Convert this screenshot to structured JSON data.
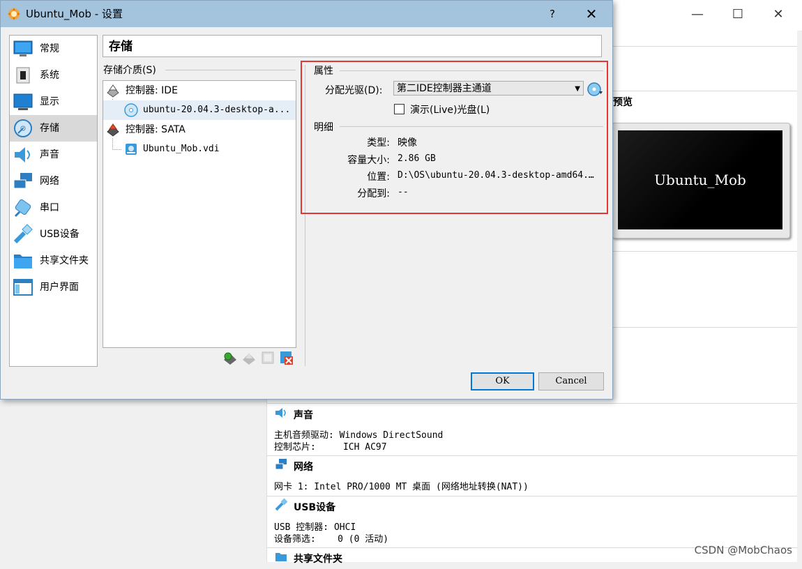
{
  "dialog": {
    "title": "Ubuntu_Mob - 设置",
    "help_label": "?",
    "close_label": "✕",
    "page_title": "存储",
    "sidebar": [
      {
        "id": "general",
        "label": "常规",
        "icon": "monitor-icon"
      },
      {
        "id": "system",
        "label": "系统",
        "icon": "chip-icon"
      },
      {
        "id": "display",
        "label": "显示",
        "icon": "display-icon"
      },
      {
        "id": "storage",
        "label": "存储",
        "icon": "disk-icon",
        "selected": true
      },
      {
        "id": "audio",
        "label": "声音",
        "icon": "speaker-icon"
      },
      {
        "id": "network",
        "label": "网络",
        "icon": "network-icon"
      },
      {
        "id": "serial",
        "label": "串口",
        "icon": "serial-port-icon"
      },
      {
        "id": "usb",
        "label": "USB设备",
        "icon": "usb-icon"
      },
      {
        "id": "shared",
        "label": "共享文件夹",
        "icon": "folder-icon"
      },
      {
        "id": "ui",
        "label": "用户界面",
        "icon": "window-icon"
      }
    ],
    "storage_media_label": "存储介质(S)",
    "tree": {
      "controller_ide": "控制器: IDE",
      "ide_disc": "ubuntu-20.04.3-desktop-a...",
      "controller_sata": "控制器: SATA",
      "sata_disk": "Ubuntu_Mob.vdi"
    },
    "attributes": {
      "group_title": "属性",
      "drive_label": "分配光驱(D):",
      "drive_value": "第二IDE控制器主通道",
      "live_label": "演示(Live)光盘(L)",
      "live_checked": false
    },
    "details": {
      "group_title": "明细",
      "type_label": "类型:",
      "type_value": "映像",
      "size_label": "容量大小:",
      "size_value": "2.86  GB",
      "location_label": "位置:",
      "location_value": "D:\\OS\\ubuntu-20.04.3-desktop-amd64.…",
      "attached_label": "分配到:",
      "attached_value": "--"
    },
    "ok_label": "OK",
    "cancel_label": "Cancel"
  },
  "background": {
    "minimize": "—",
    "maximize": "☐",
    "close": "✕",
    "preview_label": "预览",
    "preview_vm_name": "Ubuntu_Mob",
    "audio": {
      "title": "声音",
      "line1": "主机音频驱动: Windows DirectSound",
      "line2": "控制芯片:     ICH AC97"
    },
    "network": {
      "title": "网络",
      "line1": "网卡 1: Intel PRO/1000 MT 桌面 (网络地址转换(NAT))"
    },
    "usb": {
      "title": "USB设备",
      "line1": "USB 控制器: OHCI",
      "line2": "设备筛选:    0 (0 活动)"
    },
    "shared": {
      "title": "共享文件夹"
    }
  },
  "watermark": "CSDN @MobChaos",
  "colors": {
    "highlight_box": "#e53535",
    "titlebar": "#a4c4dd",
    "accent": "#0078d7"
  }
}
